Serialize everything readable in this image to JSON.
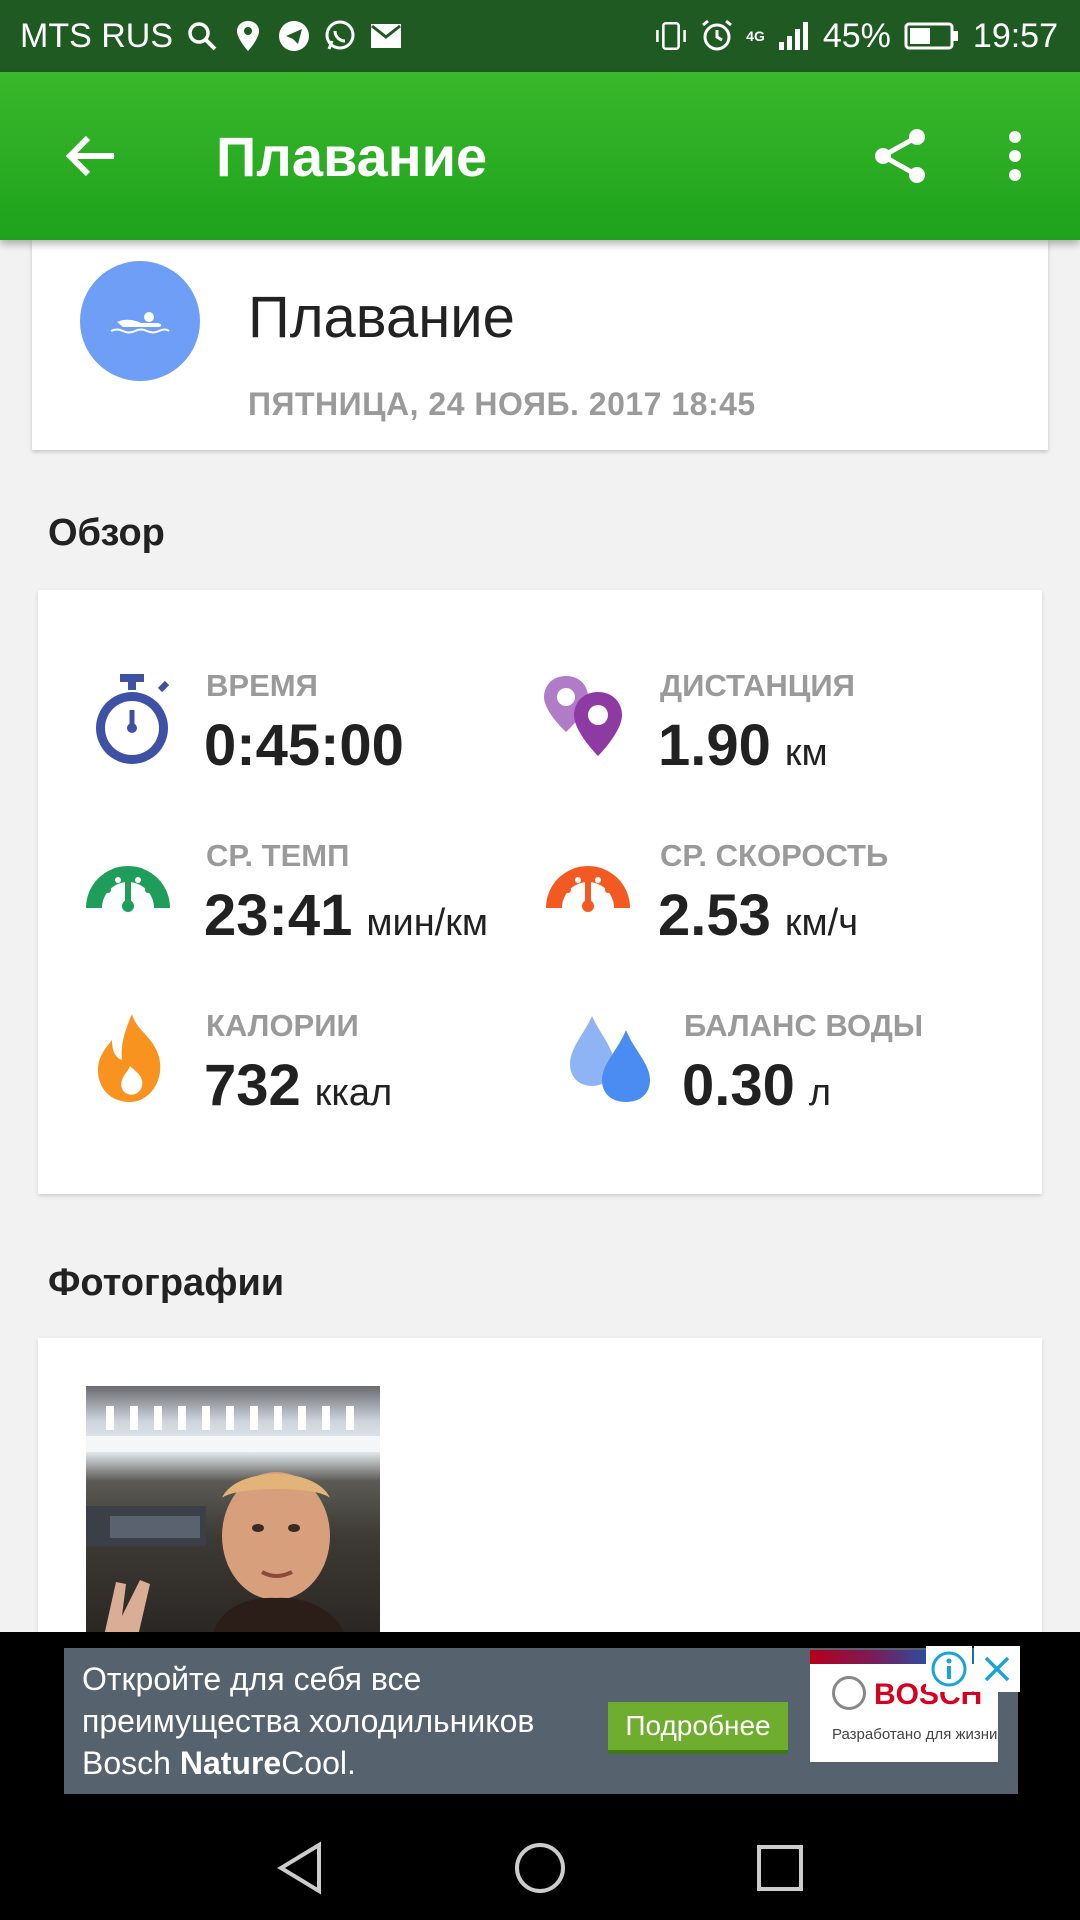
{
  "status_bar": {
    "carrier": "MTS RUS",
    "network": "4G",
    "battery": "45%",
    "time": "19:57",
    "left_icons": [
      "search-icon",
      "location-icon",
      "telegram-icon",
      "whatsapp-icon",
      "mail-icon"
    ],
    "right_icons": [
      "vibrate-icon",
      "alarm-icon",
      "signal-icon",
      "battery-icon"
    ]
  },
  "app_bar": {
    "title": "Плавание",
    "background_color": "#2aa822",
    "icons": [
      "arrow-back-icon",
      "share-icon",
      "more-vert-icon"
    ]
  },
  "activity": {
    "title": "Плавание",
    "date": "ПЯТНИЦА, 24 НОЯБ. 2017 18:45",
    "icon": "swimmer-icon",
    "icon_bg_color": "#6f9ef6"
  },
  "overview": {
    "section_title": "Обзор",
    "stats": [
      {
        "label": "ВРЕМЯ",
        "value": "0:45:00",
        "unit": "",
        "icon": "stopwatch-icon",
        "color": "#3f51a5"
      },
      {
        "label": "ДИСТАНЦИЯ",
        "value": "1.90",
        "unit": "км",
        "icon": "map-pin-icon",
        "color": "#8e3aa3"
      },
      {
        "label": "СР. ТЕМП",
        "value": "23:41",
        "unit": "мин/км",
        "icon": "speedometer-green-icon",
        "color": "#1e9e5a"
      },
      {
        "label": "СР. СКОРОСТЬ",
        "value": "2.53",
        "unit": "км/ч",
        "icon": "speedometer-orange-icon",
        "color": "#f25a22"
      },
      {
        "label": "КАЛОРИИ",
        "value": "732",
        "unit": "ккал",
        "icon": "flame-icon",
        "color": "#f7931e"
      },
      {
        "label": "БАЛАНС ВОДЫ",
        "value": "0.30",
        "unit": "л",
        "icon": "water-drops-icon",
        "color": "#4a8cf2"
      }
    ]
  },
  "photos": {
    "section_title": "Фотографии",
    "items": [
      "photo-thumbnail"
    ]
  },
  "ad": {
    "text_line1": "Откройте для себя все",
    "text_line2": "преимущества холодильников",
    "text_line3_prefix": "Bosch ",
    "text_line3_bold": "Nature",
    "text_line3_suffix": "Cool.",
    "cta": "Подробнее",
    "brand": "BOSCH",
    "tagline": "Разработано для жизни",
    "icons": [
      "ad-info-icon",
      "ad-close-icon"
    ]
  },
  "nav_bar": {
    "icons": [
      "nav-back-icon",
      "nav-home-icon",
      "nav-recents-icon"
    ]
  }
}
